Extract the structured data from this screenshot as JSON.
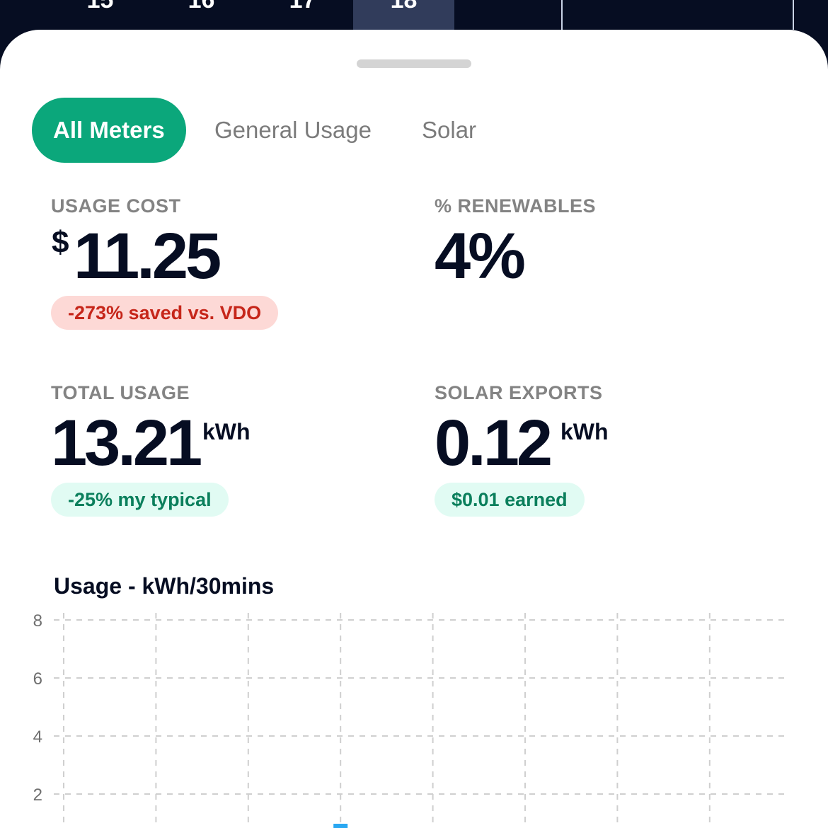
{
  "date_strip": {
    "cells": [
      {
        "label": "15"
      },
      {
        "label": "16"
      },
      {
        "label": "17"
      },
      {
        "label": "18"
      }
    ],
    "selected_index": 3,
    "selected_color": "#313c5b"
  },
  "tabs": [
    {
      "label": "All Meters",
      "active": true
    },
    {
      "label": "General Usage",
      "active": false
    },
    {
      "label": "Solar",
      "active": false
    }
  ],
  "stats": {
    "usage_cost": {
      "label": "USAGE COST",
      "currency": "$",
      "value": "11.25",
      "badge": "-273% saved vs. VDO",
      "badge_tone": "bad"
    },
    "renewables": {
      "label": "% RENEWABLES",
      "value": "4%"
    },
    "total_usage": {
      "label": "TOTAL USAGE",
      "value": "13.21",
      "unit": "kWh",
      "badge": "-25% my typical",
      "badge_tone": "good"
    },
    "solar_exports": {
      "label": "SOLAR EXPORTS",
      "value": "0.12",
      "unit": "kWh",
      "badge": "$0.01 earned",
      "badge_tone": "good"
    }
  },
  "colors": {
    "accent": "#0ba77b",
    "dark": "#060d22",
    "bar": "#2aa8f2"
  },
  "chart_data": {
    "type": "bar",
    "title": "Usage - kWh/30mins",
    "y_ticks": [
      2,
      4,
      6,
      8
    ],
    "ylim": [
      0,
      8
    ],
    "grid": true,
    "visible_bars": [
      {
        "slot": 3,
        "value": 0.15
      }
    ]
  }
}
